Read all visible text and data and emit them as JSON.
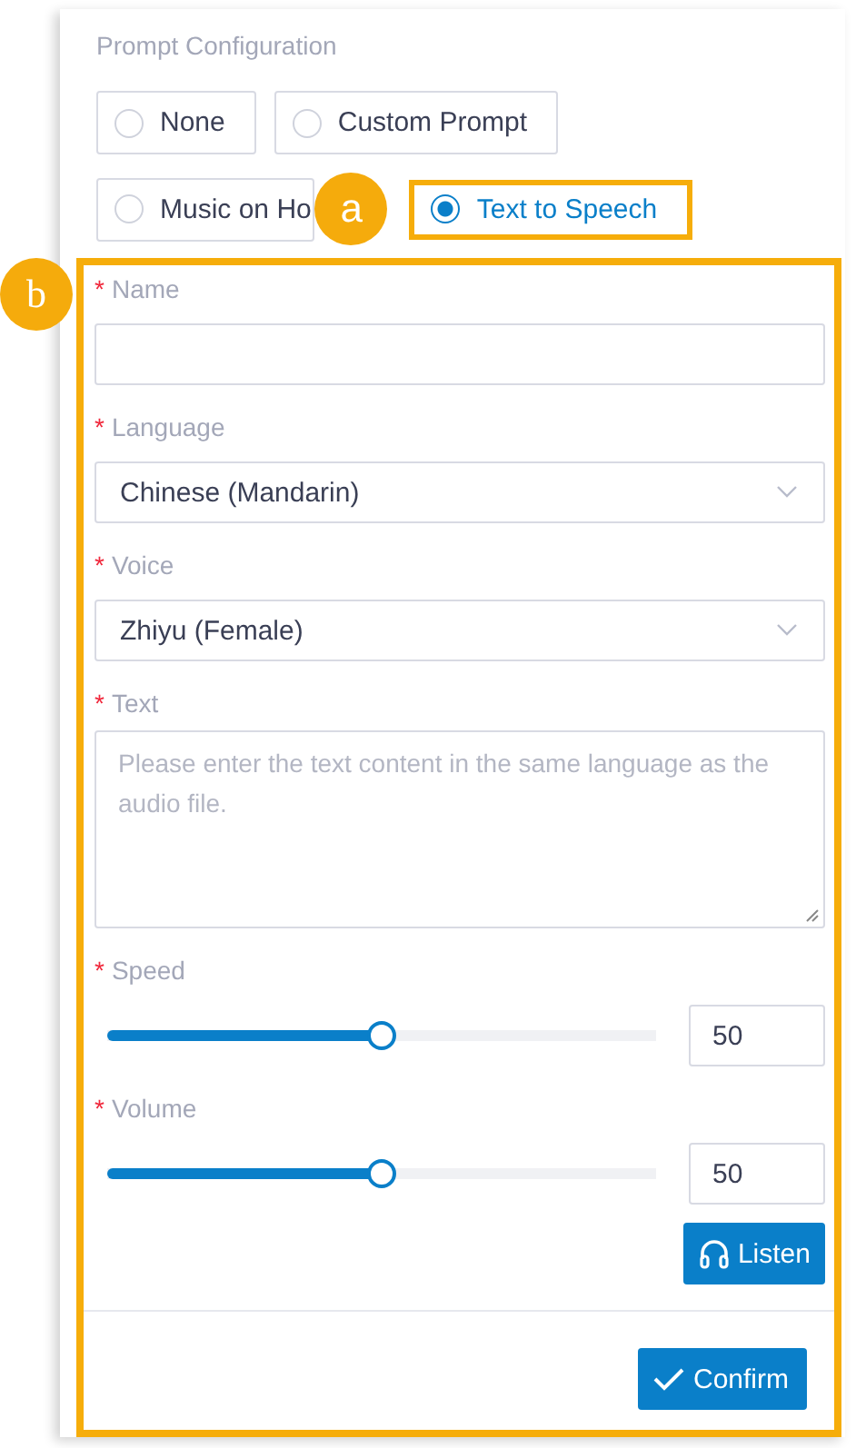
{
  "title": "Prompt Configuration",
  "prompt_options": [
    {
      "label": "None",
      "selected": false
    },
    {
      "label": "Custom Prompt",
      "selected": false
    },
    {
      "label": "Music on Ho",
      "selected": false
    },
    {
      "label": "Text to Speech",
      "selected": true
    }
  ],
  "fields": [
    {
      "kind": "input",
      "label": "Name",
      "required_mark": "*"
    },
    {
      "kind": "select",
      "label": "Language",
      "required_mark": "*",
      "value": "Chinese (Mandarin)"
    },
    {
      "kind": "select",
      "label": "Voice",
      "required_mark": "*",
      "value": "Zhiyu (Female)"
    },
    {
      "kind": "textarea",
      "label": "Text",
      "required_mark": "*",
      "placeholder": "Please enter the text content in the same language as the audio file."
    },
    {
      "kind": "slider",
      "label": "Speed",
      "required_mark": "*",
      "level": 0.5,
      "value": "50"
    },
    {
      "kind": "slider",
      "label": "Volume",
      "required_mark": "*",
      "level": 0.5,
      "value": "50"
    }
  ],
  "listen_button": "Listen",
  "confirm_button": "Confirm",
  "annotations": [
    {
      "label": "a"
    },
    {
      "label": "b"
    }
  ]
}
